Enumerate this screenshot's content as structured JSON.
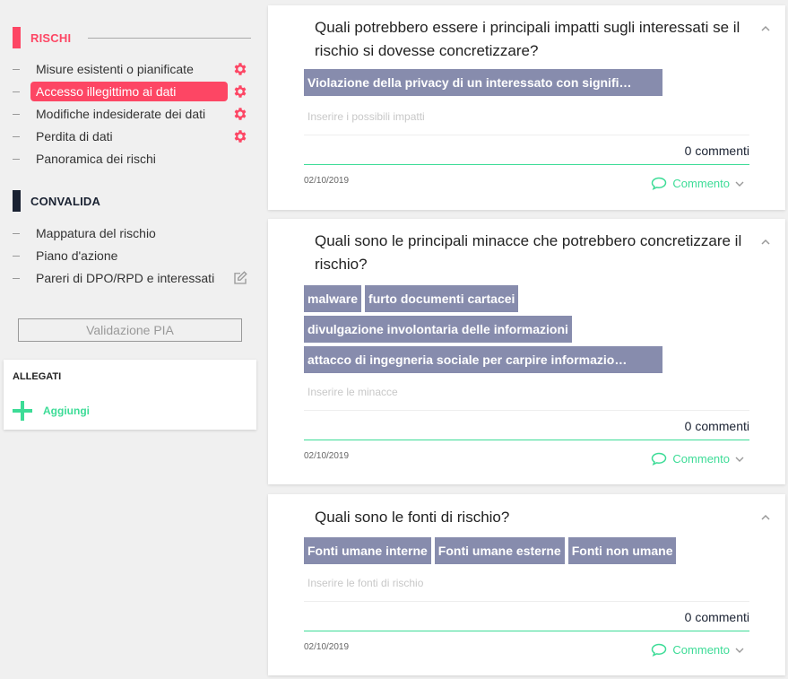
{
  "sidebar": {
    "rischi_title": "RISCHI",
    "rischi_items": [
      {
        "label": "Misure esistenti o pianificate",
        "icon": "gear-icon"
      },
      {
        "label": "Accesso illegittimo ai dati",
        "icon": "gear-icon",
        "active": true
      },
      {
        "label": "Modifiche indesiderate dei dati",
        "icon": "gear-icon"
      },
      {
        "label": "Perdita di dati",
        "icon": "gear-icon"
      },
      {
        "label": "Panoramica dei rischi"
      }
    ],
    "convalida_title": "CONVALIDA",
    "convalida_items": [
      {
        "label": "Mappatura del rischio"
      },
      {
        "label": "Piano d'azione"
      },
      {
        "label": "Pareri di DPO/RPD e interessati",
        "icon": "edit-icon"
      }
    ],
    "validate_button": "Validazione PIA",
    "attachments": {
      "title": "ALLEGATI",
      "add_label": "Aggiungi"
    }
  },
  "cards": [
    {
      "question": "Quali potrebbero essere i principali impatti sugli interessati se il rischio si dovesse concretizzare?",
      "chips": [
        "Violazione della privacy di un interessato con signifi…"
      ],
      "placeholder": "Inserire i possibili impatti",
      "comments": "0 commenti",
      "date": "02/10/2019",
      "comment_label": "Commento"
    },
    {
      "question": "Quali sono le principali minacce che potrebbero concretizzare il rischio?",
      "chips": [
        "malware",
        "furto documenti cartacei",
        "divulgazione involontaria delle informazioni",
        "attacco di ingegneria sociale per carpire informazio…"
      ],
      "placeholder": "Inserire le minacce",
      "comments": "0 commenti",
      "date": "02/10/2019",
      "comment_label": "Commento"
    },
    {
      "question": "Quali sono le fonti di rischio?",
      "chips": [
        "Fonti umane interne",
        "Fonti umane esterne",
        "Fonti non umane"
      ],
      "placeholder": "Inserire le fonti di rischio",
      "comments": "0 commenti",
      "date": "02/10/2019",
      "comment_label": "Commento"
    }
  ],
  "colors": {
    "accent_red": "#fd4664",
    "accent_green": "#3ddc97",
    "chip": "#878cad",
    "dark": "#1a2232"
  }
}
